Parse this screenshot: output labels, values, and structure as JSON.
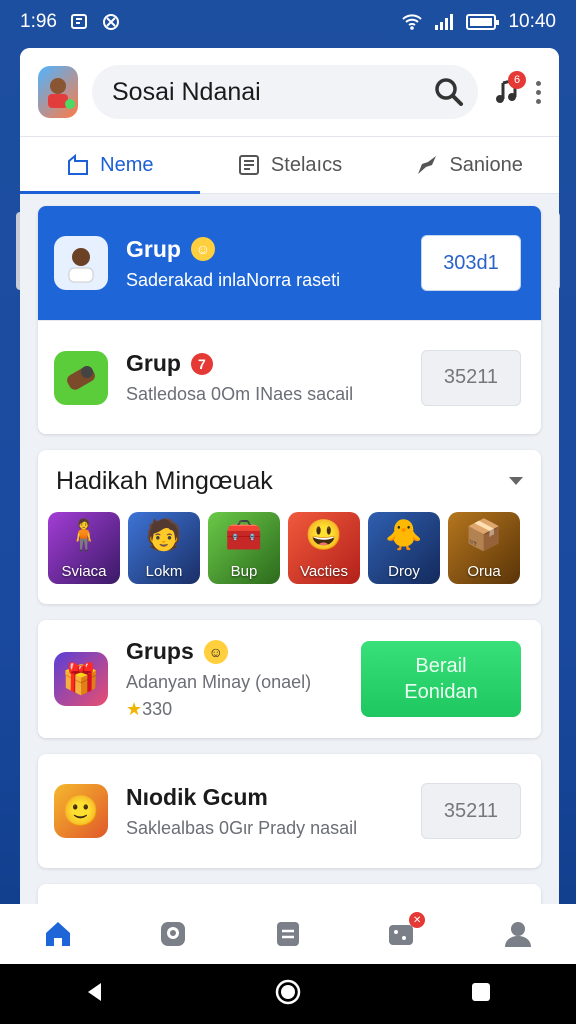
{
  "status_bar": {
    "time": "1:96",
    "clock": "10:40"
  },
  "header": {
    "search": {
      "value": "Sosai Ndanai"
    },
    "music_badge": "6"
  },
  "tabs": [
    {
      "label": "Neme",
      "active": true
    },
    {
      "label": "Stelaıcs",
      "active": false
    },
    {
      "label": "Sanione",
      "active": false
    }
  ],
  "groups_card": [
    {
      "title": "Grup",
      "subtitle": "Saderakad inlaNorra raseti",
      "button": "303d1",
      "highlighted": true
    },
    {
      "title": "Grup",
      "badge": "7",
      "subtitle": "Satledosa 0Om INaes sacail",
      "button": "35211",
      "highlighted": false
    }
  ],
  "section": {
    "title": "Hadikah Mingœuak",
    "tiles": [
      {
        "label": "Sviaca",
        "color": "#7a2fa0"
      },
      {
        "label": "Lokm",
        "color": "#2d4f9a"
      },
      {
        "label": "Bup",
        "color": "#3b8a2b"
      },
      {
        "label": "Vacties",
        "color": "#d63a2a"
      },
      {
        "label": "Droy",
        "color": "#1f3f7a"
      },
      {
        "label": "Orua",
        "color": "#7a4a12"
      }
    ]
  },
  "promo_card": {
    "title": "Grups",
    "subtitle": "Adanyan Minay (onael)",
    "stars": "330",
    "button_line1": "Berail",
    "button_line2": "Eonidan"
  },
  "last_card": {
    "title": "Nıodik Gcum",
    "subtitle": "Saklealbas 0Gιr Prady nasail",
    "button": "35211"
  },
  "colors": {
    "accent": "#1e66d8",
    "green": "#22cc66",
    "badge": "#e53935"
  }
}
